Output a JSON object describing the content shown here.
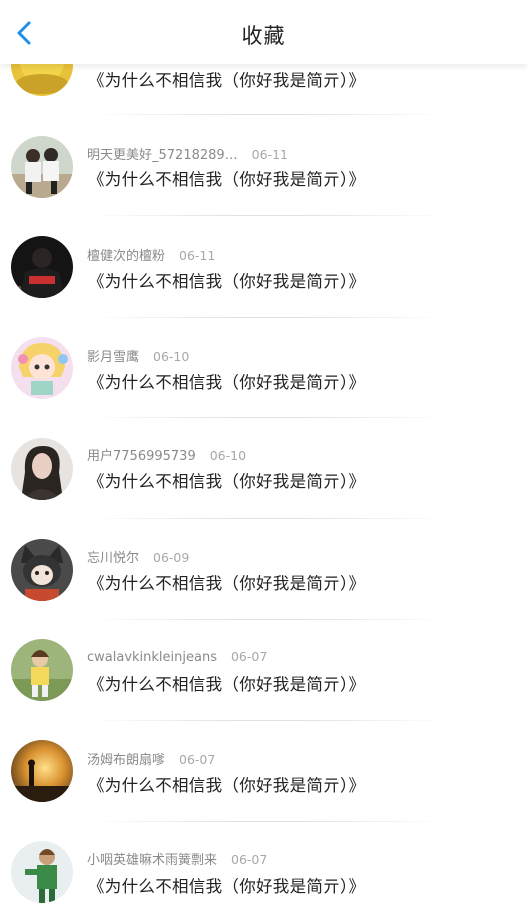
{
  "header": {
    "title": "收藏"
  },
  "items": [
    {
      "user": "",
      "time": "",
      "text": "《为什么不相信我（你好我是简亓）》"
    },
    {
      "user": "明天更美好_57218289…",
      "time": "06-11",
      "text": "《为什么不相信我（你好我是简亓）》"
    },
    {
      "user": "檀健次的檀粉",
      "time": "06-11",
      "text": "《为什么不相信我（你好我是简亓）》"
    },
    {
      "user": "影月雪鹰",
      "time": "06-10",
      "text": "《为什么不相信我（你好我是简亓）》"
    },
    {
      "user": "用户7756995739",
      "time": "06-10",
      "text": "《为什么不相信我（你好我是简亓）》"
    },
    {
      "user": "忘川悦尔",
      "time": "06-09",
      "text": "《为什么不相信我（你好我是简亓）》"
    },
    {
      "user": "cwalavkinkleinjeans",
      "time": "06-07",
      "text": "《为什么不相信我（你好我是简亓）》"
    },
    {
      "user": "汤姆布朗扇嗲",
      "time": "06-07",
      "text": "《为什么不相信我（你好我是简亓）》"
    },
    {
      "user": "小咽英雄嘛术雨簧剽来",
      "time": "06-07",
      "text": "《为什么不相信我（你好我是简亓）》"
    }
  ]
}
